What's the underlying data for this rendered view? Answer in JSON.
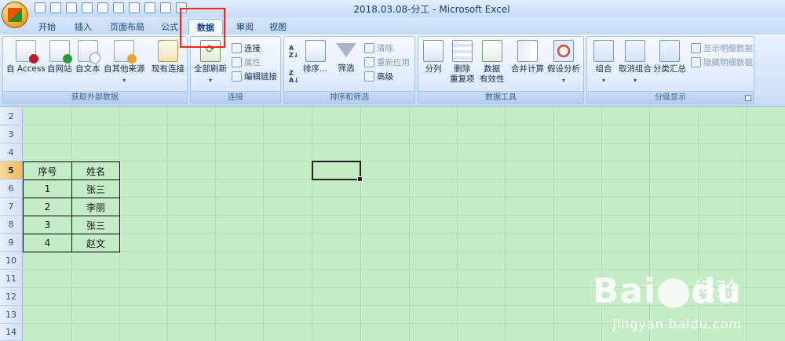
{
  "window": {
    "title": "2018.03.08-分工 - Microsoft Excel"
  },
  "tabs": [
    {
      "label": "开始",
      "active": false
    },
    {
      "label": "插入",
      "active": false
    },
    {
      "label": "页面布局",
      "active": false
    },
    {
      "label": "公式",
      "active": false
    },
    {
      "label": "数据",
      "active": true
    },
    {
      "label": "审阅",
      "active": false
    },
    {
      "label": "视图",
      "active": false
    }
  ],
  "ribbon": {
    "external": {
      "label": "获取外部数据",
      "access": "自 Access",
      "web": "自网站",
      "text": "自文本",
      "other": "自其他来源",
      "existing": "现有连接"
    },
    "connections": {
      "label": "连接",
      "refresh_all": "全部刷新",
      "connections": "连接",
      "properties": "属性",
      "edit_links": "编辑链接"
    },
    "sort_filter": {
      "label": "排序和筛选",
      "sort": "排序...",
      "filter": "筛选",
      "clear": "清除",
      "reapply": "重新应用",
      "advanced": "高级"
    },
    "data_tools": {
      "label": "数据工具",
      "text_to_columns": "分列",
      "remove_duplicates_1": "删除",
      "remove_duplicates_2": "重复项",
      "validation_1": "数据",
      "validation_2": "有效性",
      "consolidate": "合并计算",
      "what_if": "假设分析"
    },
    "outline": {
      "label": "分级显示",
      "group": "组合",
      "ungroup": "取消组合",
      "subtotal": "分类汇总",
      "show_detail": "显示明细数据",
      "hide_detail": "隐藏明细数据"
    }
  },
  "rows": [
    "2",
    "3",
    "4",
    "5",
    "6",
    "7",
    "8",
    "9",
    "10",
    "11",
    "12",
    "13",
    "14"
  ],
  "table": {
    "headers": [
      "序号",
      "姓名"
    ],
    "rows": [
      [
        "1",
        "张三"
      ],
      [
        "2",
        "李丽"
      ],
      [
        "3",
        "张三"
      ],
      [
        "4",
        "赵文"
      ]
    ]
  },
  "watermark": {
    "brand_a": "Bai",
    "brand_b": "du",
    "brand_cn": "经验",
    "url": "jingyan.baidu.com"
  }
}
